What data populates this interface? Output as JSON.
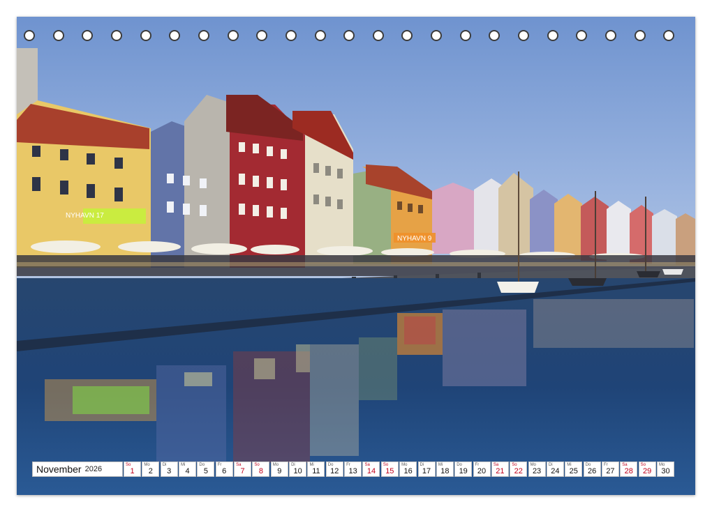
{
  "calendar": {
    "month": "November",
    "year": "2026",
    "days": [
      {
        "wd": "So",
        "d": "1",
        "we": true
      },
      {
        "wd": "Mo",
        "d": "2",
        "we": false
      },
      {
        "wd": "Di",
        "d": "3",
        "we": false
      },
      {
        "wd": "Mi",
        "d": "4",
        "we": false
      },
      {
        "wd": "Do",
        "d": "5",
        "we": false
      },
      {
        "wd": "Fr",
        "d": "6",
        "we": false
      },
      {
        "wd": "Sa",
        "d": "7",
        "we": true
      },
      {
        "wd": "So",
        "d": "8",
        "we": true
      },
      {
        "wd": "Mo",
        "d": "9",
        "we": false
      },
      {
        "wd": "Di",
        "d": "10",
        "we": false
      },
      {
        "wd": "Mi",
        "d": "11",
        "we": false
      },
      {
        "wd": "Do",
        "d": "12",
        "we": false
      },
      {
        "wd": "Fr",
        "d": "13",
        "we": false
      },
      {
        "wd": "Sa",
        "d": "14",
        "we": true
      },
      {
        "wd": "So",
        "d": "15",
        "we": true
      },
      {
        "wd": "Mo",
        "d": "16",
        "we": false
      },
      {
        "wd": "Di",
        "d": "17",
        "we": false
      },
      {
        "wd": "Mi",
        "d": "18",
        "we": false
      },
      {
        "wd": "Do",
        "d": "19",
        "we": false
      },
      {
        "wd": "Fr",
        "d": "20",
        "we": false
      },
      {
        "wd": "Sa",
        "d": "21",
        "we": true
      },
      {
        "wd": "So",
        "d": "22",
        "we": true
      },
      {
        "wd": "Mo",
        "d": "23",
        "we": false
      },
      {
        "wd": "Di",
        "d": "24",
        "we": false
      },
      {
        "wd": "Mi",
        "d": "25",
        "we": false
      },
      {
        "wd": "Do",
        "d": "26",
        "we": false
      },
      {
        "wd": "Fr",
        "d": "27",
        "we": false
      },
      {
        "wd": "Sa",
        "d": "28",
        "we": true
      },
      {
        "wd": "So",
        "d": "29",
        "we": true
      },
      {
        "wd": "Mo",
        "d": "30",
        "we": false
      }
    ]
  },
  "photo": {
    "subject": "Nyhavn canal at dusk",
    "signs": [
      "NYHAVN 9",
      "NYHAVN 17"
    ],
    "colors": {
      "sky": "#7d9fd4",
      "water": "#1d3f70",
      "weekend": "#c0001a"
    }
  },
  "binding_holes": 23
}
